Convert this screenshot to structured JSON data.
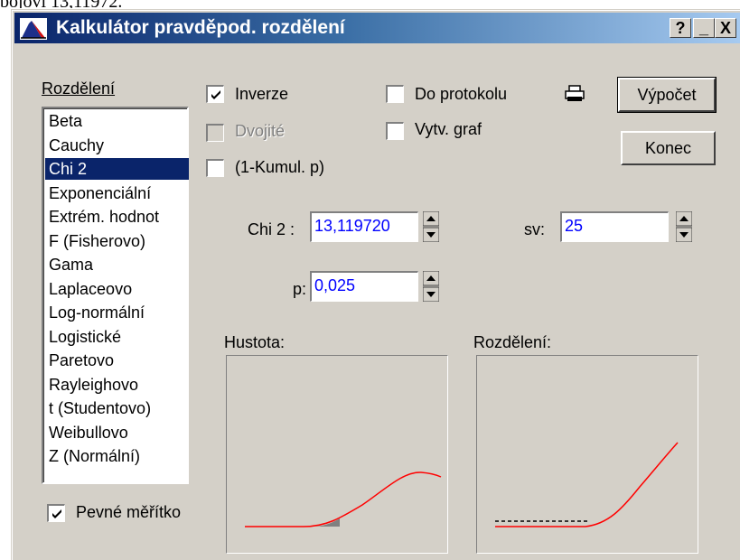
{
  "top_text": "bojovi 13,11972.",
  "window": {
    "title": "Kalkulátor pravděpod. rozdělení",
    "help_button": "?",
    "minimize_button": "_",
    "close_button": "X"
  },
  "distribution": {
    "group_label": "Rozdělení",
    "items": [
      "Beta",
      "Cauchy",
      "Chi 2",
      "Exponenciální",
      "Extrém. hodnot",
      "F (Fisherovo)",
      "Gama",
      "Laplaceovo",
      "Log-normální",
      "Logistické",
      "Paretovo",
      "Rayleighovo",
      "t (Studentovo)",
      "Weibullovo",
      "Z (Normální)"
    ],
    "selected": "Chi 2"
  },
  "options": {
    "inverze": {
      "label": "Inverze",
      "checked": true
    },
    "dvojite": {
      "label": "Dvojité",
      "checked": false,
      "enabled": false
    },
    "kumul": {
      "label": "(1-Kumul. p)",
      "checked": false
    },
    "do_protokolu": {
      "label": "Do protokolu",
      "checked": false
    },
    "vytv_graf": {
      "label": "Vytv. graf",
      "checked": false
    },
    "pevne_meritko": {
      "label": "Pevné měřítko",
      "checked": true
    }
  },
  "buttons": {
    "vypocet": "Výpočet",
    "konec": "Konec"
  },
  "inputs": {
    "chi2_label": "Chi 2 :",
    "chi2_value": "13,119720",
    "sv_label": "sv:",
    "sv_value": "25",
    "p_label": "p:",
    "p_value": "0,025"
  },
  "plots": {
    "density_label": "Hustota:",
    "distribution_label": "Rozdělení:"
  },
  "colors": {
    "titlebar_start": "#0a246a",
    "titlebar_end": "#a6caf0",
    "curve": "#ff0000",
    "input_text": "#0000ff",
    "shaded_area": "#808080"
  },
  "icons": {
    "app": "distribution-triangle-icon",
    "printer": "printer-icon",
    "check": "check-icon"
  }
}
